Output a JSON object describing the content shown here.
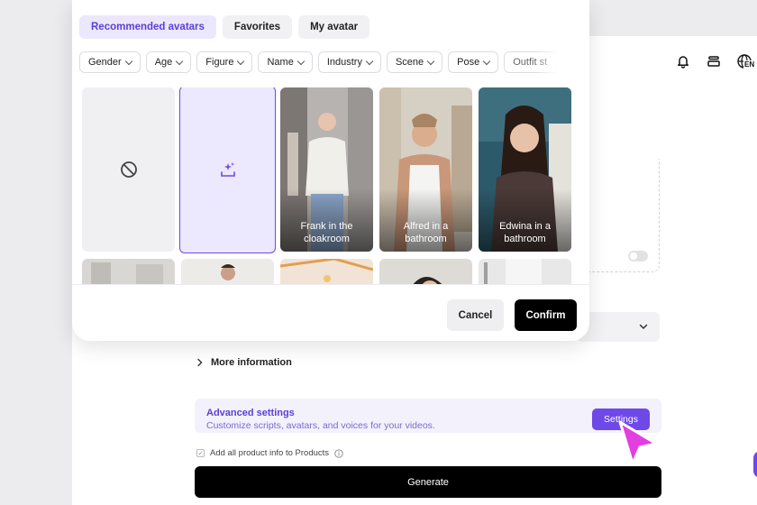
{
  "modal": {
    "tabs": [
      {
        "label": "Recommended avatars",
        "active": true
      },
      {
        "label": "Favorites",
        "active": false
      },
      {
        "label": "My avatar",
        "active": false
      }
    ],
    "filters": [
      "Gender",
      "Age",
      "Figure",
      "Name",
      "Industry",
      "Scene",
      "Pose",
      "Outfit st"
    ],
    "avatars": [
      {
        "caption": "Frank in the cloakroom"
      },
      {
        "caption": "Alfred in a bathroom"
      },
      {
        "caption": "Edwina in a bathroom"
      }
    ],
    "cancel_label": "Cancel",
    "confirm_label": "Confirm"
  },
  "page": {
    "more_info_label": "More information",
    "advanced": {
      "title": "Advanced settings",
      "subtitle": "Customize scripts, avatars, and voices for your videos.",
      "settings_label": "Settings"
    },
    "checkbox_label": "Add all product info to Products",
    "generate_label": "Generate",
    "language_badge": "EN"
  },
  "colors": {
    "accent": "#6f48e8",
    "cursor": "#e23ee0"
  }
}
